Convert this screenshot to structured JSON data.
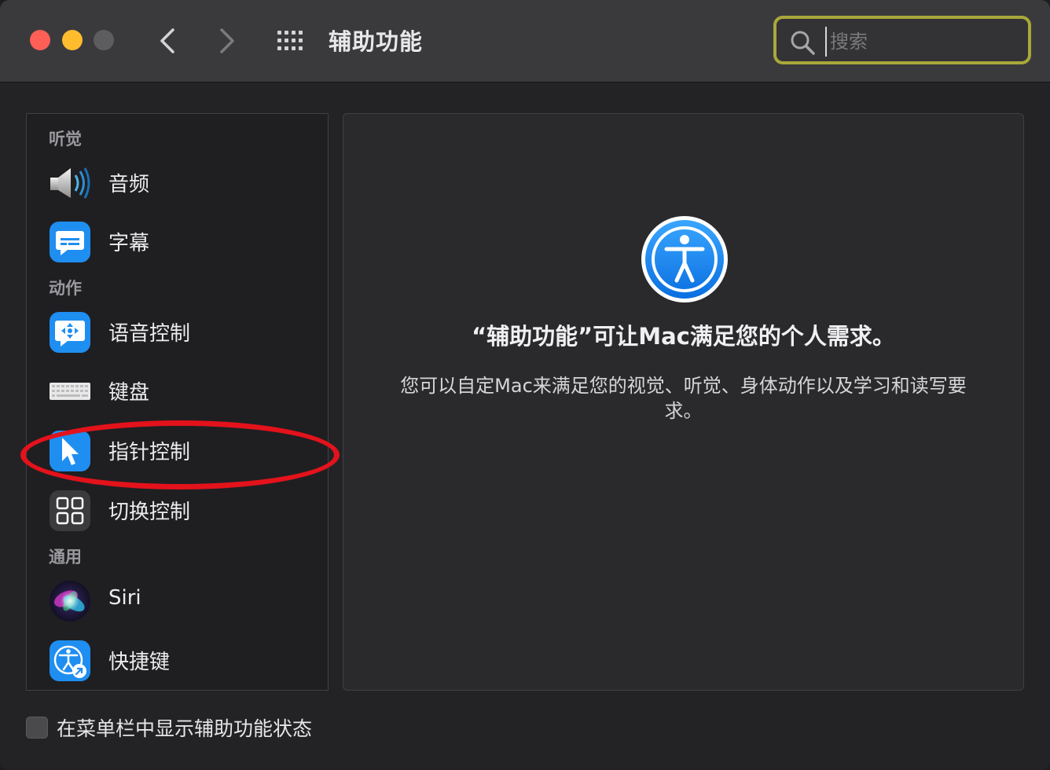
{
  "window": {
    "title": "辅助功能"
  },
  "search": {
    "placeholder": "搜索",
    "value": ""
  },
  "sidebar": {
    "sections": [
      {
        "header": "听觉",
        "items": [
          {
            "label": "音频",
            "icon": "speaker-icon"
          },
          {
            "label": "字幕",
            "icon": "captions-icon"
          }
        ]
      },
      {
        "header": "动作",
        "items": [
          {
            "label": "语音控制",
            "icon": "voice-control-icon"
          },
          {
            "label": "键盘",
            "icon": "keyboard-icon"
          },
          {
            "label": "指针控制",
            "icon": "pointer-icon"
          },
          {
            "label": "切换控制",
            "icon": "switch-control-icon"
          }
        ]
      },
      {
        "header": "通用",
        "items": [
          {
            "label": "Siri",
            "icon": "siri-icon"
          },
          {
            "label": "快捷键",
            "icon": "shortcut-icon"
          }
        ]
      }
    ]
  },
  "main": {
    "headline": "“辅助功能”可让Mac满足您的个人需求。",
    "description": "您可以自定Mac来满足您的视觉、听觉、身体动作以及学习和读写要求。"
  },
  "footer": {
    "checkbox_label": "在菜单栏中显示辅助功能状态",
    "checked": false
  },
  "colors": {
    "accent_blue": "#1f8ef1",
    "search_highlight": "#a9a83a",
    "annotation_red": "#e3121b"
  }
}
